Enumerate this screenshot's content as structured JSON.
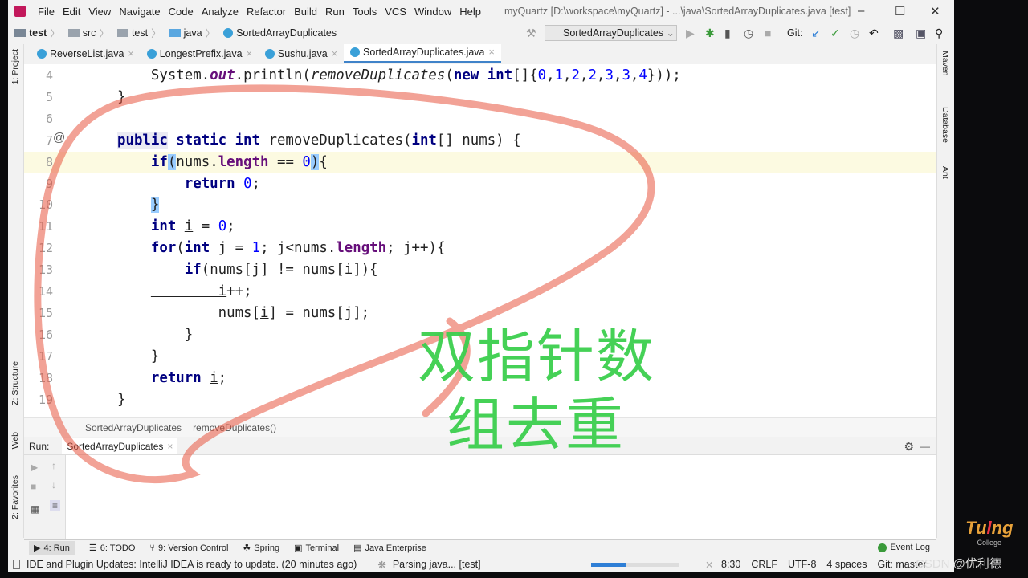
{
  "menu": {
    "items": [
      "File",
      "Edit",
      "View",
      "Navigate",
      "Code",
      "Analyze",
      "Refactor",
      "Build",
      "Run",
      "Tools",
      "VCS",
      "Window",
      "Help"
    ],
    "title": "myQuartz [D:\\workspace\\myQuartz] - ...\\java\\SortedArrayDuplicates.java [test]"
  },
  "breadcrumb": [
    "test",
    "src",
    "test",
    "java",
    "SortedArrayDuplicates"
  ],
  "toolbar": {
    "run_config": "SortedArrayDuplicates",
    "git_label": "Git:"
  },
  "tabs": [
    {
      "label": "ReverseList.java"
    },
    {
      "label": "LongestPrefix.java"
    },
    {
      "label": "Sushu.java"
    },
    {
      "label": "SortedArrayDuplicates.java",
      "active": true
    }
  ],
  "left_tools": [
    "1: Project",
    "Z: Structure",
    "Web",
    "2: Favorites"
  ],
  "right_tools": [
    "Maven",
    "Database",
    "Ant"
  ],
  "editor": {
    "line_numbers": [
      "4",
      "5",
      "6",
      "7",
      "8",
      "9",
      "10",
      "11",
      "12",
      "13",
      "14",
      "15",
      "16",
      "17",
      "18",
      "19"
    ],
    "current_line": "8",
    "lines": [
      [
        [
          "",
          "System."
        ],
        [
          "fi",
          "out"
        ],
        [
          "",
          ".println("
        ],
        [
          "i",
          "removeDuplicates"
        ],
        [
          "",
          "("
        ],
        [
          "k",
          "new"
        ],
        [
          "",
          ""
        ],
        [
          "k",
          " int"
        ],
        [
          "",
          "[]{"
        ],
        [
          "n",
          "0"
        ],
        [
          "",
          ","
        ],
        [
          "n",
          "1"
        ],
        [
          "",
          ","
        ],
        [
          "n",
          "2"
        ],
        [
          "",
          ","
        ],
        [
          "n",
          "2"
        ],
        [
          "",
          ","
        ],
        [
          "n",
          "3"
        ],
        [
          "",
          ","
        ],
        [
          "n",
          "3"
        ],
        [
          "",
          ","
        ],
        [
          "n",
          "4"
        ],
        [
          "",
          "}));"
        ]
      ],
      [
        [
          "",
          "}"
        ]
      ],
      [],
      [
        [
          "k h2",
          "public"
        ],
        [
          "k",
          " static int "
        ],
        [
          "",
          "removeDuplicates("
        ],
        [
          "k",
          "int"
        ],
        [
          "",
          "[] nums) {"
        ]
      ],
      [
        [
          "k",
          "if"
        ],
        [
          "hl",
          "("
        ],
        [
          "",
          "nums."
        ],
        [
          "f",
          "length"
        ],
        [
          "",
          "",
          " == "
        ],
        [
          "",
          " == "
        ],
        [
          "n",
          "0"
        ],
        [
          "hl",
          ")"
        ],
        [
          "",
          "{"
        ]
      ],
      [
        [
          "k",
          "    return "
        ],
        [
          "n",
          "0"
        ],
        [
          "",
          ";"
        ]
      ],
      [
        [
          "hl",
          "}"
        ]
      ],
      [
        [
          "k",
          "int "
        ],
        [
          "u",
          "i"
        ],
        [
          "",
          " = "
        ],
        [
          "n",
          "0"
        ],
        [
          "",
          ";"
        ]
      ],
      [
        [
          "k",
          "for"
        ],
        [
          "",
          "("
        ],
        [
          "k",
          "int"
        ],
        [
          "",
          " j = "
        ],
        [
          "n",
          "1"
        ],
        [
          "",
          "; j<nums."
        ],
        [
          "f",
          "length"
        ],
        [
          "",
          "; j++){"
        ]
      ],
      [
        [
          "k",
          "    if"
        ],
        [
          "",
          "(nums[j] != nums["
        ],
        [
          "u",
          "i"
        ],
        [
          "",
          "]){"
        ]
      ],
      [
        [
          "u",
          "        i"
        ],
        [
          "",
          "++;"
        ]
      ],
      [
        [
          "",
          "        nums["
        ],
        [
          "u",
          "i"
        ],
        [
          "",
          "] = nums[j];"
        ]
      ],
      [
        [
          "",
          "    }"
        ]
      ],
      [
        [
          "",
          "}"
        ]
      ],
      [
        [
          "k",
          "return "
        ],
        [
          "u",
          "i"
        ],
        [
          "",
          ";"
        ]
      ],
      [
        [
          "",
          "}"
        ]
      ]
    ],
    "indent": [
      2,
      1,
      0,
      1,
      2,
      2,
      2,
      2,
      2,
      2,
      2,
      2,
      2,
      2,
      2,
      1
    ]
  },
  "editor_breadcrumb": [
    "SortedArrayDuplicates",
    "removeDuplicates()"
  ],
  "run_panel": {
    "label": "Run:",
    "tab": "SortedArrayDuplicates"
  },
  "bottom_tools": [
    "4: Run",
    "6: TODO",
    "9: Version Control",
    "Spring",
    "Terminal",
    "Java Enterprise"
  ],
  "event_log": "Event Log",
  "status": {
    "message": "IDE and Plugin Updates: IntelliJ IDEA is ready to update. (20 minutes ago)",
    "task": "Parsing java... [test]",
    "progress_percent": 40,
    "position": "8:30",
    "line_sep": "CRLF",
    "encoding": "UTF-8",
    "indent": "4 spaces",
    "git": "Git: master"
  },
  "overlay": {
    "annotation_line1": "双指针数",
    "annotation_line2": "组去重",
    "annotation_color": "#3ccf4e",
    "ellipse_color": "#e8553f"
  },
  "watermark": {
    "brand": "Tuling College",
    "csdn": "CSDN @优利德"
  }
}
